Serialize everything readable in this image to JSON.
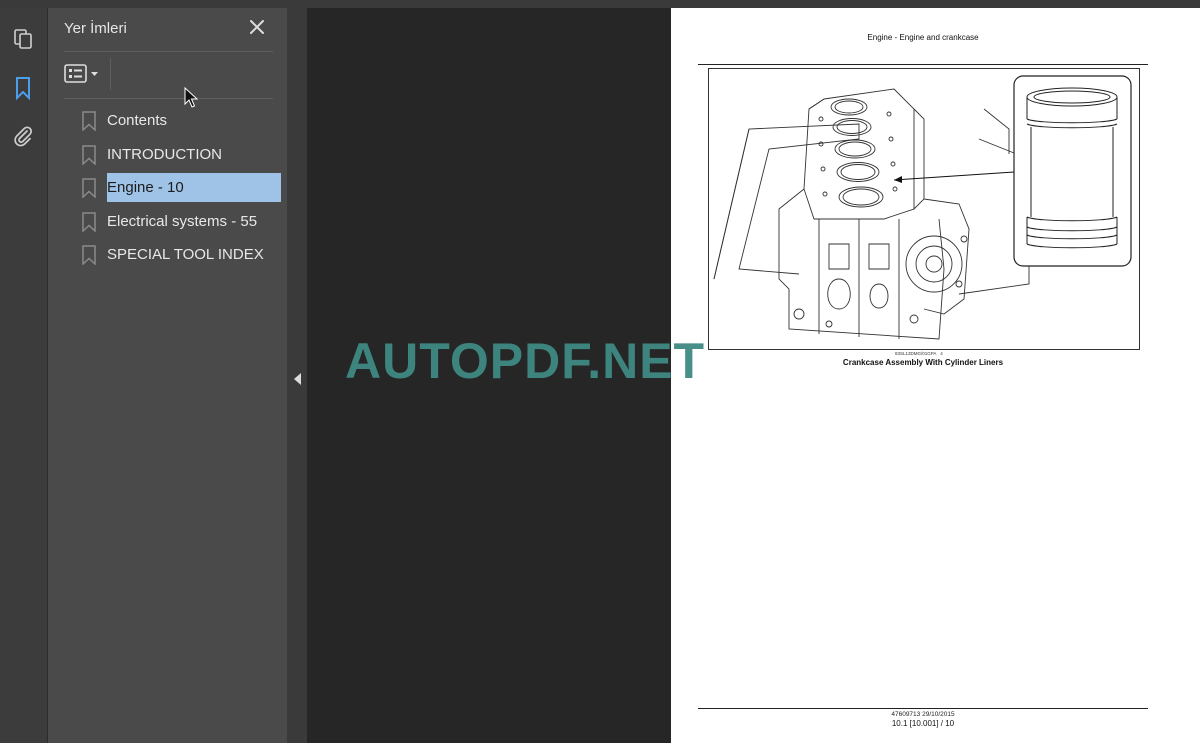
{
  "sidebar_rail": {
    "items": [
      {
        "icon": "pages-icon"
      },
      {
        "icon": "bookmark-icon",
        "active": true
      },
      {
        "icon": "attachment-icon"
      }
    ],
    "accent": "#4a9fe8"
  },
  "bookmarks_panel": {
    "title": "Yer İmleri",
    "close_icon": "close-icon",
    "options_icon": "list-options-icon",
    "items": [
      {
        "label": "Contents"
      },
      {
        "label": "INTRODUCTION"
      },
      {
        "label": "Engine - 10",
        "selected": true
      },
      {
        "label": "Electrical systems - 55"
      },
      {
        "label": "SPECIAL TOOL INDEX"
      }
    ],
    "selected_color": "#9ec3e6"
  },
  "document": {
    "header": "Engine - Engine and crankcase",
    "figure_code": "83SL13DMG/01GPA",
    "figure_number": "4",
    "caption": "Crankcase Assembly With Cylinder Liners",
    "footer_doc": "47609713 29/10/2015",
    "footer_page": "10.1 [10.001] / 10"
  },
  "watermark": {
    "text": "AUTOPDF.NET",
    "color": "#3f8a83"
  }
}
